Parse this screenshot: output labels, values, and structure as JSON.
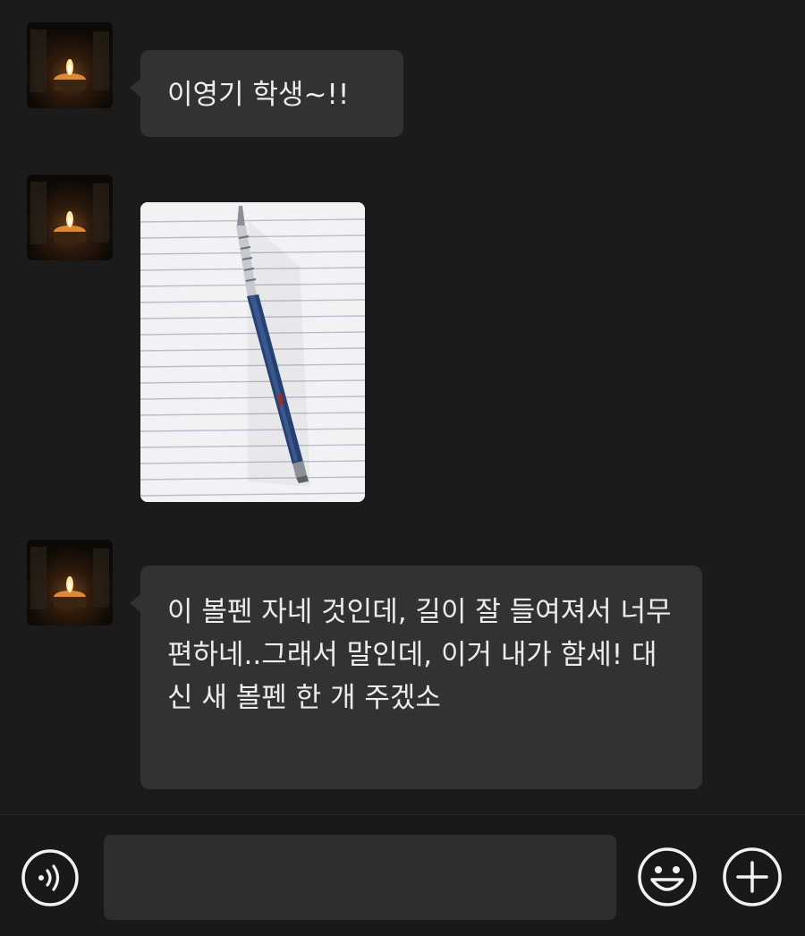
{
  "messages": [
    {
      "type": "text",
      "sender_avatar": "candle-avatar",
      "text": "이영기 학생~!!"
    },
    {
      "type": "image",
      "sender_avatar": "candle-avatar",
      "image": "ballpoint-pen-on-lined-paper"
    },
    {
      "type": "text",
      "sender_avatar": "candle-avatar",
      "text": "이 볼펜 자네 것인데, 길이 잘 들여져서 너무 편하네..그래서 말인데, 이거 내가 함세! 대신 새 볼펜 한 개 주겠소"
    }
  ],
  "input_bar": {
    "message_value": "",
    "voice_icon": "voice-message-icon",
    "emoji_icon": "smiley-face-icon",
    "plus_icon": "plus-icon"
  },
  "colors": {
    "background": "#1b1b1b",
    "bubble": "#323232",
    "text": "#ececec",
    "icon": "#f2f2f2",
    "input_field": "#2e2e2e"
  }
}
